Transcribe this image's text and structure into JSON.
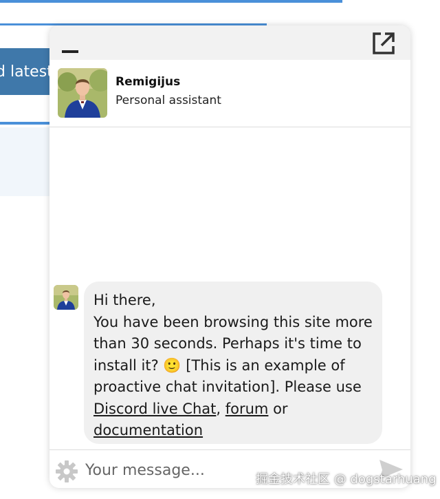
{
  "background": {
    "banner_text": "d latest"
  },
  "chat": {
    "minimize_icon": "minimize-icon",
    "popout_icon": "external-link-icon",
    "agent": {
      "name": "Remigijus",
      "role": "Personal assistant"
    },
    "message": {
      "line1": "Hi there,",
      "line2": "You have been browsing this site more",
      "line3": "than 30 seconds. Perhaps it's time to",
      "line4_before": "install it? ",
      "emoji": "🙂",
      "line4_after": " [This is an example of",
      "line5": "proactive chat invitation]. Please use",
      "link_discord": "Discord live Chat",
      "sep1": ", ",
      "link_forum": "forum",
      "sep2": " or",
      "link_docs": "documentation"
    },
    "composer": {
      "placeholder": "Your message...",
      "settings_icon": "gear-icon",
      "send_icon": "send-icon"
    }
  },
  "watermark": "掘金技术社区 @ dogstarhuang",
  "colors": {
    "accent": "#4a90d9",
    "banner": "#3f78aa",
    "bubble": "#f0f0f0",
    "topbar": "#f2f2f2"
  }
}
